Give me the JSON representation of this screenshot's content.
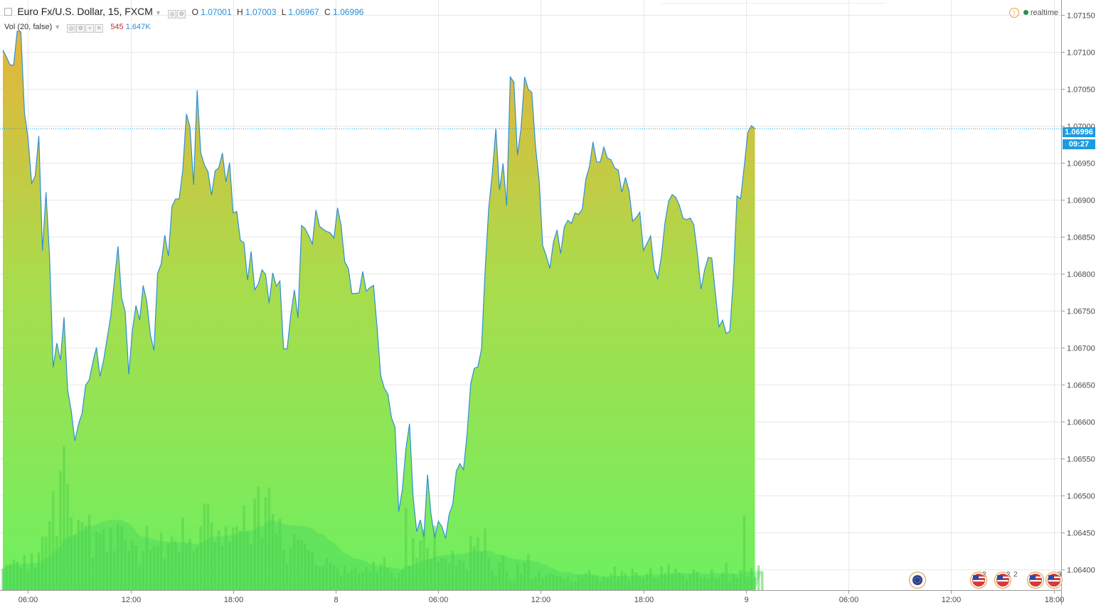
{
  "legend": {
    "title": "Euro Fx/U.S. Dollar, 15, FXCM",
    "o_label": "O",
    "o_value": "1.07001",
    "h_label": "H",
    "h_value": "1.07003",
    "l_label": "L",
    "l_value": "1.06967",
    "c_label": "C",
    "c_value": "1.06996",
    "vol_label": "Vol (20, false)",
    "vol_value": "545",
    "vol_ma_value": "1.647K"
  },
  "status": {
    "text": "realtime",
    "warn_glyph": "!"
  },
  "price_tag": {
    "price": "1.06996",
    "countdown": "09:27"
  },
  "events": {
    "flag_counts": [
      "2",
      "2",
      "2",
      "3"
    ]
  },
  "colors": {
    "line": "#2f8fd6",
    "fill_top": "#e6b43a",
    "fill_bottom": "#6ef060",
    "vol_bar": "#52d24a",
    "grid": "#e8e8e8",
    "price_tag": "#1e9be0"
  },
  "chart_data": {
    "type": "area",
    "symbol": "EURUSD",
    "interval": "15",
    "xlabel": "",
    "ylabel": "",
    "ylim": [
      1.06372,
      1.0717
    ],
    "yticks": [
      "1.07150",
      "1.07100",
      "1.07050",
      "1.07000",
      "1.06950",
      "1.06900",
      "1.06850",
      "1.06800",
      "1.06750",
      "1.06700",
      "1.06650",
      "1.06600",
      "1.06550",
      "1.06500",
      "1.06450",
      "1.06400"
    ],
    "xticks": [
      "06:00",
      "12:00",
      "18:00",
      "8",
      "06:00",
      "12:00",
      "18:00",
      "9",
      "06:00",
      "12:00",
      "18:00"
    ],
    "x_start": "06:00",
    "x_end": "18:00",
    "last_price": 1.06996,
    "grid": true,
    "series": [
      {
        "values": [
          1.07102,
          1.07093,
          1.07082,
          1.07082,
          1.07128,
          1.07127,
          1.07018,
          1.06983,
          1.06922,
          1.06932,
          1.06986,
          1.06831,
          1.0691,
          1.06821,
          1.06673,
          1.06706,
          1.06683,
          1.06741,
          1.06643,
          1.06615,
          1.06574,
          1.06596,
          1.06611,
          1.06649,
          1.06656,
          1.0668,
          1.067,
          1.06661,
          1.06683,
          1.06713,
          1.06743,
          1.06791,
          1.06837,
          1.06767,
          1.06749,
          1.06664,
          1.06724,
          1.06757,
          1.06737,
          1.06784,
          1.06762,
          1.06717,
          1.06696,
          1.068,
          1.06813,
          1.06852,
          1.06824,
          1.06891,
          1.06901,
          1.06901,
          1.0694,
          1.07016,
          1.06998,
          1.0692,
          1.07048,
          1.06963,
          1.06947,
          1.06938,
          1.06906,
          1.06939,
          1.06943,
          1.06963,
          1.06924,
          1.0695,
          1.06882,
          1.06884,
          1.06845,
          1.06842,
          1.06791,
          1.0683,
          1.06778,
          1.06786,
          1.06805,
          1.06799,
          1.0676,
          1.06801,
          1.06783,
          1.0679,
          1.06698,
          1.06698,
          1.06744,
          1.06778,
          1.0674,
          1.06865,
          1.06861,
          1.06851,
          1.0684,
          1.06886,
          1.06864,
          1.0686,
          1.06857,
          1.06855,
          1.06848,
          1.06889,
          1.06865,
          1.06816,
          1.06807,
          1.06773,
          1.06773,
          1.06774,
          1.06803,
          1.06776,
          1.06781,
          1.06784,
          1.06727,
          1.06662,
          1.06645,
          1.06637,
          1.06605,
          1.06592,
          1.06478,
          1.06508,
          1.06563,
          1.06597,
          1.06499,
          1.06451,
          1.06467,
          1.06444,
          1.06528,
          1.06474,
          1.06443,
          1.06465,
          1.06458,
          1.06442,
          1.06474,
          1.06488,
          1.06533,
          1.06543,
          1.06535,
          1.06583,
          1.06651,
          1.06672,
          1.06674,
          1.06698,
          1.06803,
          1.06888,
          1.06936,
          1.06996,
          1.06913,
          1.06949,
          1.06892,
          1.07066,
          1.07059,
          1.0696,
          1.06997,
          1.07066,
          1.07049,
          1.07045,
          1.06972,
          1.06928,
          1.06838,
          1.06824,
          1.06807,
          1.06843,
          1.06859,
          1.06827,
          1.06863,
          1.06872,
          1.06868,
          1.06882,
          1.0688,
          1.06887,
          1.06928,
          1.06945,
          1.06978,
          1.06951,
          1.06951,
          1.06971,
          1.06956,
          1.06954,
          1.06943,
          1.0694,
          1.0691,
          1.0693,
          1.06912,
          1.06871,
          1.06876,
          1.06883,
          1.06831,
          1.06841,
          1.06851,
          1.06806,
          1.06793,
          1.06824,
          1.06869,
          1.06898,
          1.06907,
          1.06903,
          1.06892,
          1.06875,
          1.06873,
          1.06875,
          1.06866,
          1.06827,
          1.06779,
          1.06805,
          1.06822,
          1.06821,
          1.06773,
          1.06728,
          1.06737,
          1.06719,
          1.06722,
          1.06794,
          1.06905,
          1.06901,
          1.06945,
          1.06991,
          1.07,
          1.06996
        ]
      }
    ],
    "volume": {
      "values": [
        280,
        330,
        340,
        390,
        370,
        290,
        460,
        250,
        480,
        300,
        490,
        690,
        700,
        900,
        1290,
        710,
        1550,
        1880,
        1380,
        950,
        720,
        910,
        890,
        840,
        980,
        420,
        760,
        730,
        790,
        500,
        810,
        510,
        870,
        840,
        650,
        510,
        650,
        580,
        330,
        510,
        840,
        520,
        580,
        570,
        750,
        410,
        600,
        700,
        650,
        490,
        940,
        600,
        670,
        510,
        560,
        830,
        1130,
        1120,
        880,
        630,
        780,
        580,
        830,
        630,
        820,
        830,
        780,
        1100,
        760,
        590,
        1190,
        1350,
        690,
        1210,
        1340,
        990,
        740,
        930,
        530,
        340,
        550,
        730,
        660,
        660,
        600,
        520,
        500,
        330,
        310,
        320,
        420,
        350,
        320,
        300,
        200,
        320,
        220,
        270,
        300,
        230,
        240,
        300,
        240,
        370,
        230,
        340,
        430,
        280,
        230,
        160,
        220,
        270,
        1070,
        320,
        680,
        420,
        650,
        790,
        550,
        410,
        840,
        370,
        420,
        410,
        350,
        510,
        330,
        400,
        370,
        270,
        700,
        580,
        690,
        500,
        800,
        430,
        250,
        190,
        360,
        440,
        250,
        140,
        120,
        350,
        210,
        360,
        470,
        140,
        170,
        250,
        150,
        200,
        220,
        200,
        180,
        180,
        150,
        180,
        120,
        110,
        200,
        170,
        220,
        260,
        190,
        180,
        110,
        170,
        160,
        210,
        310,
        170,
        250,
        220,
        130,
        280,
        230,
        170,
        150,
        210,
        280,
        160,
        150,
        310,
        220,
        330,
        220,
        280,
        230,
        190,
        140,
        200,
        270,
        240,
        160,
        170,
        150,
        270,
        150,
        160,
        230,
        350,
        110,
        210,
        160,
        260,
        970,
        170,
        290,
        170,
        320,
        240
      ]
    }
  }
}
